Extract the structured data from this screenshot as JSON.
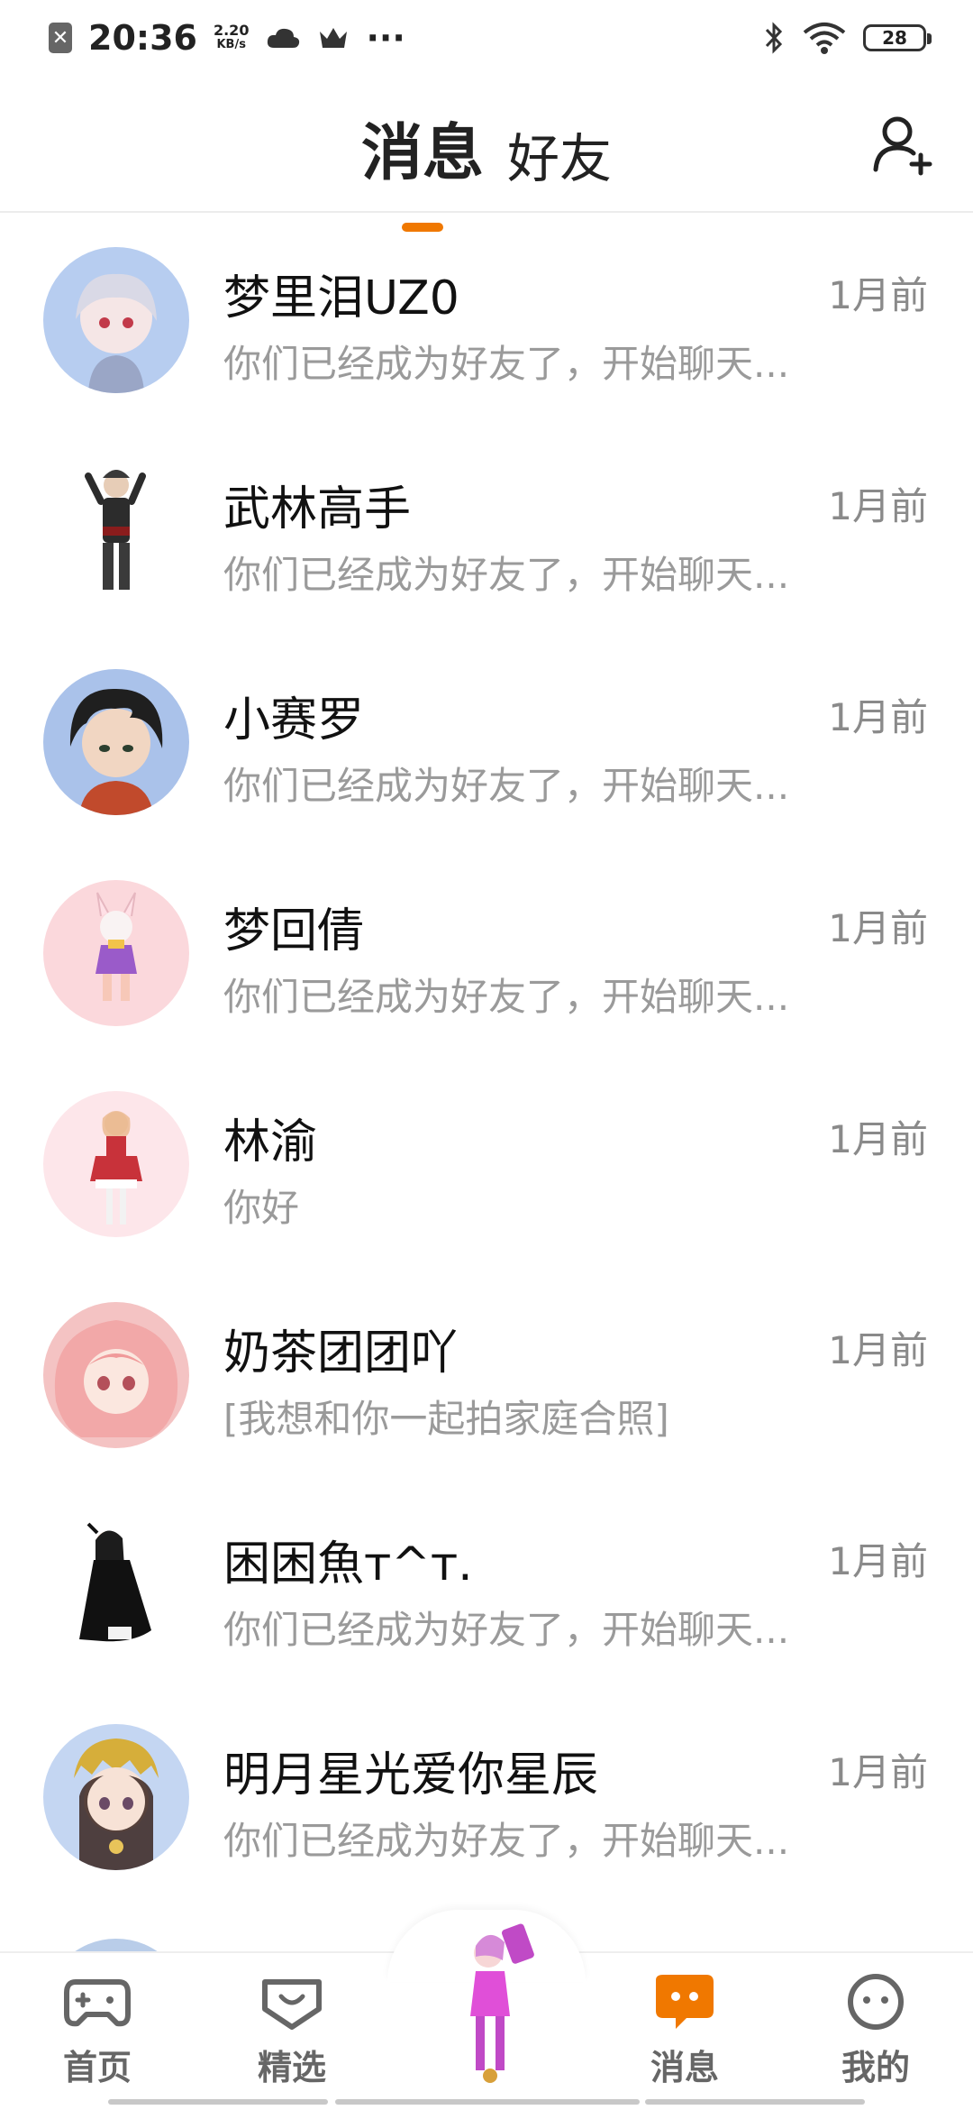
{
  "status_bar": {
    "time": "20:36",
    "net_speed_value": "2.20",
    "net_speed_unit": "KB/s",
    "battery": "28",
    "more": "···"
  },
  "header": {
    "tabs": [
      {
        "label": "消息",
        "active": true
      },
      {
        "label": "好友",
        "active": false
      }
    ],
    "accent_color": "#f07800",
    "add_friend_icon": "add-user-icon"
  },
  "conversations": [
    {
      "name": "梦里泪UZ0",
      "time": "1月前",
      "preview": "你们已经成为好友了，开始聊天...",
      "avatar_color": "#b7cdf0"
    },
    {
      "name": "武林高手",
      "time": "1月前",
      "preview": "你们已经成为好友了，开始聊天...",
      "avatar_color": "#ffffff"
    },
    {
      "name": "小赛罗",
      "time": "1月前",
      "preview": "你们已经成为好友了，开始聊天...",
      "avatar_color": "#aac2ea"
    },
    {
      "name": "梦回倩",
      "time": "1月前",
      "preview": "你们已经成为好友了，开始聊天...",
      "avatar_color": "#fbd8dc"
    },
    {
      "name": "林渝",
      "time": "1月前",
      "preview": "你好",
      "avatar_color": "#fde6ea"
    },
    {
      "name": "奶茶团团吖",
      "time": "1月前",
      "preview": "[我想和你一起拍家庭合照]",
      "avatar_color": "#f4c3c3"
    },
    {
      "name": "困困魚ᴛ^ᴛ.",
      "time": "1月前",
      "preview": "你们已经成为好友了，开始聊天...",
      "avatar_color": "#ffffff"
    },
    {
      "name": "明月星光爱你星辰",
      "time": "1月前",
      "preview": "你们已经成为好友了，开始聊天...",
      "avatar_color": "#c4d6f2"
    }
  ],
  "bottom_nav": {
    "items": [
      {
        "label": "首页",
        "icon": "gamepad-icon",
        "active": false
      },
      {
        "label": "精选",
        "icon": "heart-chat-icon",
        "active": false
      },
      {
        "label": "消息",
        "icon": "message-icon",
        "active": true
      },
      {
        "label": "我的",
        "icon": "face-icon",
        "active": false
      }
    ]
  }
}
